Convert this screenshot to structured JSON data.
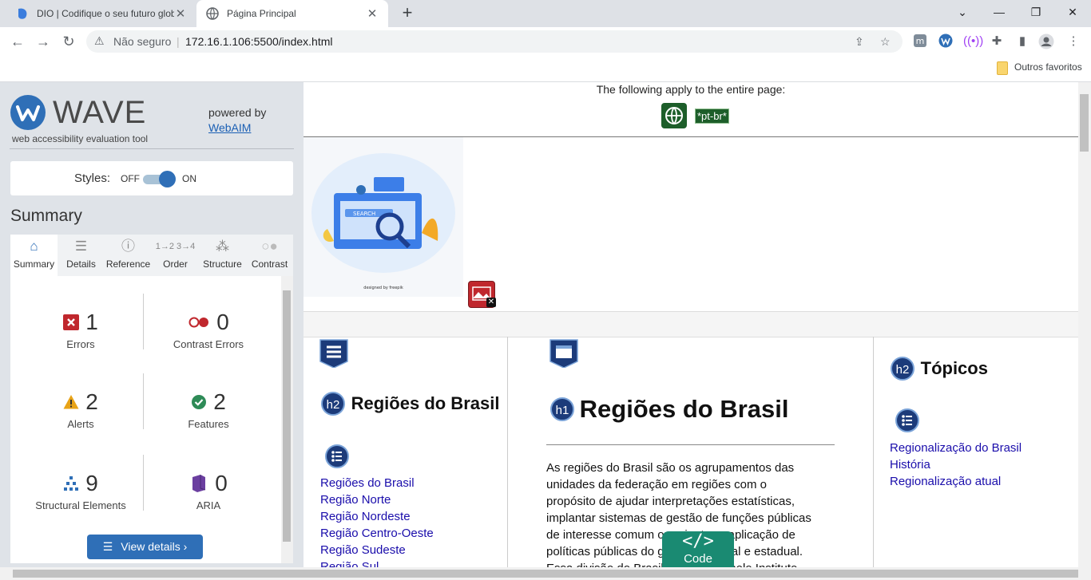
{
  "browser": {
    "tabs": [
      {
        "title": "DIO | Codifique o seu futuro glob",
        "active": false
      },
      {
        "title": "Página Principal",
        "active": true
      }
    ],
    "security_label": "Não seguro",
    "url": "172.16.1.106:5500/index.html",
    "bookmarks_folder": "Outros favoritos"
  },
  "wave": {
    "title": "WAVE",
    "subtitle": "web accessibility evaluation tool",
    "powered_by": "powered by",
    "webaim_link": "WebAIM",
    "styles_label": "Styles:",
    "toggle_off": "OFF",
    "toggle_on": "ON",
    "summary_heading": "Summary",
    "tabs": [
      "Summary",
      "Details",
      "Reference",
      "Order",
      "Structure",
      "Contrast"
    ],
    "stats": {
      "errors": {
        "value": "1",
        "label": "Errors"
      },
      "contrast_errors": {
        "value": "0",
        "label": "Contrast Errors"
      },
      "alerts": {
        "value": "2",
        "label": "Alerts"
      },
      "features": {
        "value": "2",
        "label": "Features"
      },
      "structural": {
        "value": "9",
        "label": "Structural Elements"
      },
      "aria": {
        "value": "0",
        "label": "ARIA"
      }
    },
    "view_details": "View details ›"
  },
  "page": {
    "notice": "The following apply to the entire page:",
    "lang_tag": "*pt-br*",
    "image_credit": "designed by freepik",
    "image_search_text": "SEARCH",
    "left_heading": "Regiões do Brasil",
    "left_links": [
      "Regiões do Brasil",
      "Região Norte",
      "Região Nordeste",
      "Região Centro-Oeste",
      "Região Sudeste",
      "Região Sul"
    ],
    "main_heading": "Regiões do Brasil",
    "main_paragraph_lines": [
      "As regiões do Brasil são os agrupamentos das",
      "unidades da federação em regiões com o",
      "propósito de ajudar interpretações estatísticas,",
      "implantar sistemas de gestão de funções públicas",
      "de interesse comum ou orientar a aplicação de",
      "políticas públicas do governo federal e estadual.",
      "Essa divisão do Brasil em regiões pelo Instituto"
    ],
    "right_heading": "Tópicos",
    "right_links": [
      "Regionalização do Brasil",
      "História",
      "Regionalização atual"
    ],
    "badge_h1": "h1",
    "badge_h2": "h2",
    "code_button": "Code"
  }
}
